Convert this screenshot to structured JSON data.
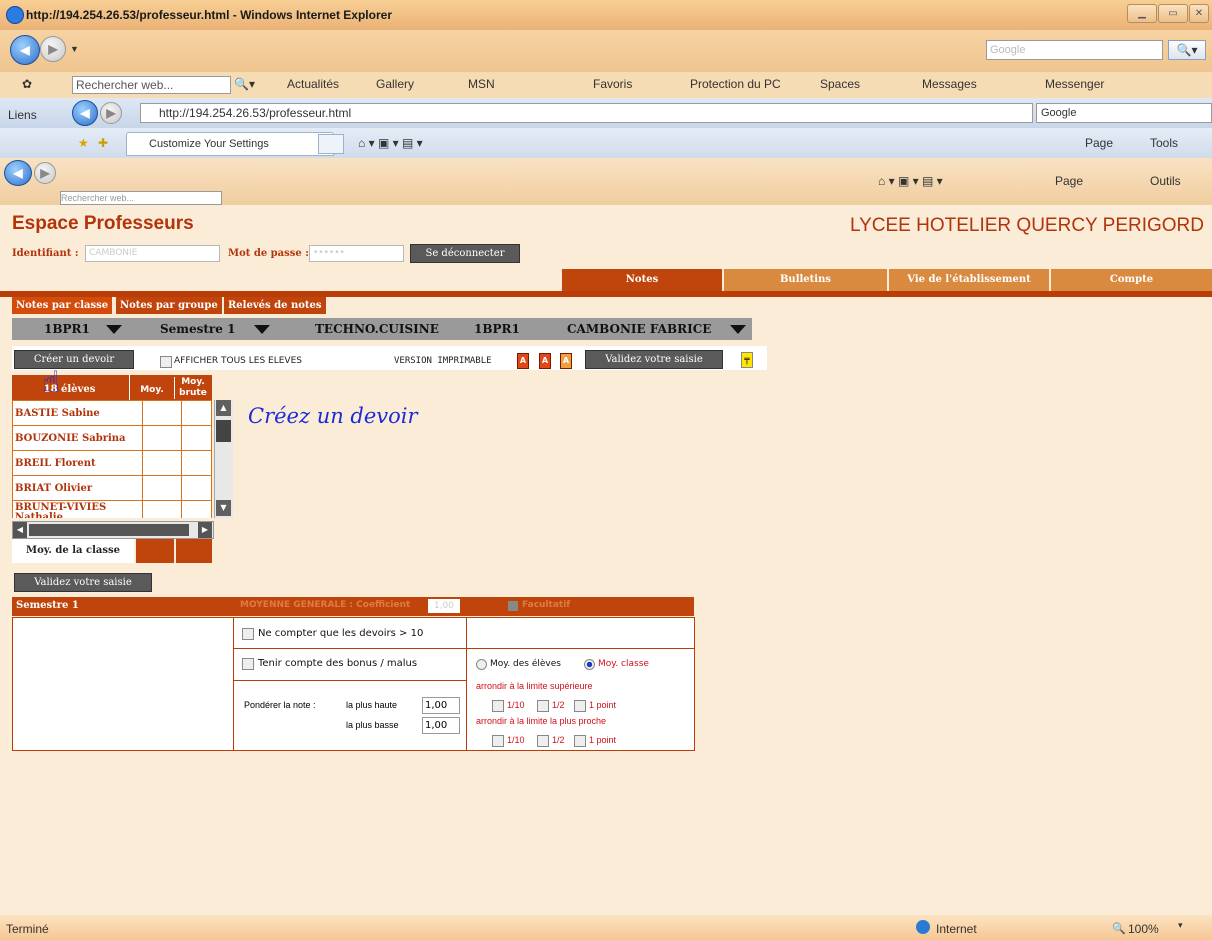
{
  "window": {
    "title": "http://194.254.26.53/professeur.html - Windows Internet Explorer"
  },
  "toolbar": {
    "google_search_placeholder": "Google",
    "search_web": "Rechercher web...",
    "actualites": "Actualités",
    "gallery": "Gallery",
    "msn": "MSN",
    "favoris": "Favoris",
    "protection": "Protection du PC",
    "spaces": "Spaces",
    "messages": "Messages",
    "messenger": "Messenger",
    "liens": "Liens",
    "address": "http://194.254.26.53/professeur.html",
    "google_box": "Google",
    "tab_label": "Customize Your Settings",
    "page_menu": "Page",
    "tools_menu": "Tools",
    "page_menu_fr": "Page",
    "outils_menu": "Outils",
    "search_web_2": "Rechercher web..."
  },
  "header": {
    "title": "Espace Professeurs",
    "school": "LYCEE HOTELIER QUERCY PERIGORD",
    "identifiant_label": "Identifiant :",
    "identifiant_value": "CAMBONIE",
    "password_label": "Mot de passe :",
    "password_value": "••••••",
    "logout_button": "Se déconnecter"
  },
  "main_tabs": [
    "Notes",
    "Bulletins",
    "Vie de l'établissement",
    "Compte"
  ],
  "sub_tabs": [
    "Notes par classe",
    "Notes par groupe",
    "Relevés de notes"
  ],
  "selectors": {
    "class": "1BPR1",
    "period": "Semestre 1",
    "subject": "TECHNO.CUISINE",
    "group": "1BPR1",
    "teacher": "CAMBONIE FABRICE"
  },
  "tools": {
    "create_button": "Créer un devoir",
    "show_all": "AFFICHER TOUS LES ELEVES",
    "print_version": "VERSION IMPRIMABLE",
    "validate_button": "Validez votre saisie",
    "pdf_icons": [
      "A",
      "A",
      "A"
    ]
  },
  "grid": {
    "count_header": "18 élèves",
    "moy_header": "Moy.",
    "moy_brute_header": "Moy. brute",
    "students": [
      "BASTIE Sabine",
      "BOUZONIE Sabrina",
      "BREIL Florent",
      "BRIAT Olivier",
      "BRUNET-VIVIES Nathalie"
    ],
    "class_average_label": "Moy. de la classe"
  },
  "annotation": "Créez un devoir",
  "validate_button_2": "Validez votre saisie",
  "semestre_bar": {
    "label": "Semestre 1",
    "general_note": "MOYENNE GENERALE : Coefficient",
    "coefficient": "1,00",
    "facultatif": "Facultatif"
  },
  "options": {
    "count_only_above_10": "Ne compter que les devoirs > 10",
    "bonus_malus": "Tenir compte des bonus / malus",
    "weight_label": "Pondérer la note :",
    "highest_label": "la plus haute",
    "highest_value": "1,00",
    "lowest_label": "la plus basse",
    "lowest_value": "1,00",
    "radio_students": "Moy. des élèves",
    "radio_class": "Moy. classe",
    "round_up": "arrondir à la limite supérieure",
    "round_near": "arrondir à la limite la plus proche",
    "round_options": [
      "1/10",
      "1/2",
      "1 point"
    ]
  },
  "status": {
    "left": "Terminé",
    "zone": "Internet",
    "zoom": "100%"
  },
  "colors": {
    "accent": "#b2340b",
    "tab_active": "#c0450c",
    "tab_inactive": "#d98a3f"
  }
}
